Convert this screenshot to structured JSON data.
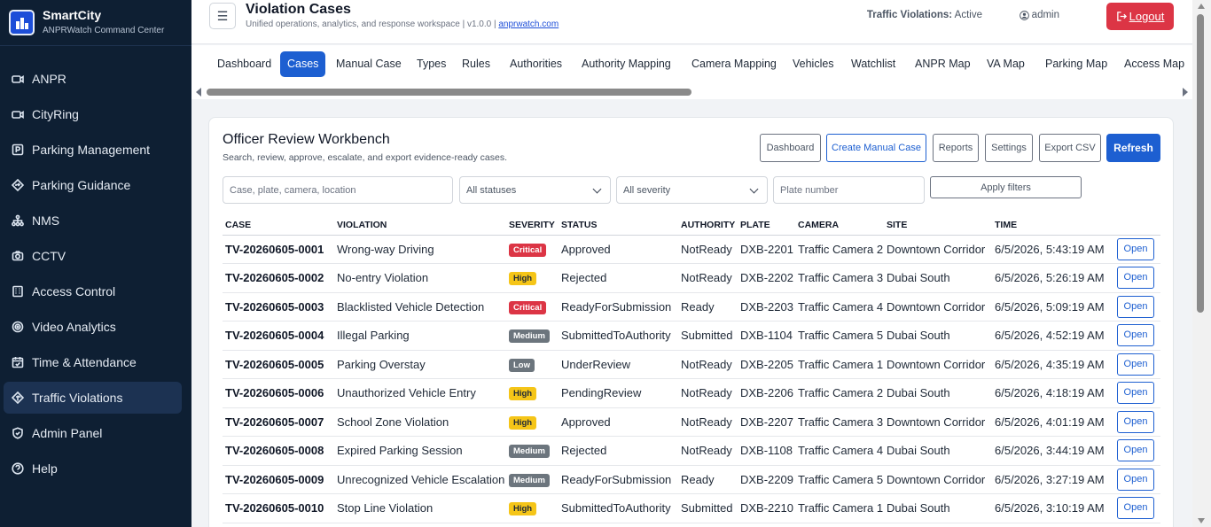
{
  "brand": {
    "title": "SmartCity",
    "subtitle": "ANPRWatch Command Center"
  },
  "sidebar": {
    "items": [
      {
        "label": "ANPR",
        "icon": "camera-icon"
      },
      {
        "label": "CityRing",
        "icon": "camera-icon"
      },
      {
        "label": "Parking Management",
        "icon": "parking-icon"
      },
      {
        "label": "Parking Guidance",
        "icon": "diamond-arrow-icon"
      },
      {
        "label": "NMS",
        "icon": "network-icon"
      },
      {
        "label": "CCTV",
        "icon": "cctv-icon"
      },
      {
        "label": "Access Control",
        "icon": "building-icon"
      },
      {
        "label": "Video Analytics",
        "icon": "target-icon"
      },
      {
        "label": "Time & Attendance",
        "icon": "calendar-check-icon"
      },
      {
        "label": "Traffic Violations",
        "icon": "signpost-icon",
        "active": true
      },
      {
        "label": "Admin Panel",
        "icon": "shield-icon"
      },
      {
        "label": "Help",
        "icon": "question-icon"
      }
    ]
  },
  "header": {
    "title": "Violation Cases",
    "subtitle_text": "Unified operations, analytics, and response workspace | v1.0.0 |",
    "subtitle_link": "anprwatch.com",
    "status_label": "Traffic Violations:",
    "status_value": "Active",
    "user": "admin",
    "logout_label": "Logout"
  },
  "tabs": [
    {
      "label": "Dashboard"
    },
    {
      "label": "Cases",
      "active": true
    },
    {
      "label": "Manual Case"
    },
    {
      "label": "Types"
    },
    {
      "label": "Rules"
    },
    {
      "label": "Authorities"
    },
    {
      "label": "Authority Mapping"
    },
    {
      "label": "Camera Mapping"
    },
    {
      "label": "Vehicles"
    },
    {
      "label": "Watchlist"
    },
    {
      "label": "ANPR Map"
    },
    {
      "label": "VA Map"
    },
    {
      "label": "Parking Map"
    },
    {
      "label": "Access Map"
    }
  ],
  "workbench": {
    "title": "Officer Review Workbench",
    "subtitle": "Search, review, approve, escalate, and export evidence-ready cases.",
    "buttons": {
      "dashboard": "Dashboard",
      "create_manual": "Create Manual Case",
      "reports": "Reports",
      "settings": "Settings",
      "export_csv": "Export CSV",
      "refresh": "Refresh"
    },
    "filters": {
      "search_placeholder": "Case, plate, camera, location",
      "status_selected": "All statuses",
      "severity_selected": "All severity",
      "plate_placeholder": "Plate number",
      "apply_label": "Apply filters"
    },
    "columns": [
      "CASE",
      "VIOLATION",
      "SEVERITY",
      "STATUS",
      "AUTHORITY",
      "PLATE",
      "CAMERA",
      "SITE",
      "TIME"
    ],
    "open_label": "Open",
    "rows": [
      {
        "case": "TV-20260605-0001",
        "violation": "Wrong-way Driving",
        "severity": "Critical",
        "status": "Approved",
        "authority": "NotReady",
        "plate": "DXB-2201",
        "camera": "Traffic Camera 2",
        "site": "Downtown Corridor",
        "time": "6/5/2026, 5:43:19 AM"
      },
      {
        "case": "TV-20260605-0002",
        "violation": "No-entry Violation",
        "severity": "High",
        "status": "Rejected",
        "authority": "NotReady",
        "plate": "DXB-2202",
        "camera": "Traffic Camera 3",
        "site": "Dubai South",
        "time": "6/5/2026, 5:26:19 AM"
      },
      {
        "case": "TV-20260605-0003",
        "violation": "Blacklisted Vehicle Detection",
        "severity": "Critical",
        "status": "ReadyForSubmission",
        "authority": "Ready",
        "plate": "DXB-2203",
        "camera": "Traffic Camera 4",
        "site": "Downtown Corridor",
        "time": "6/5/2026, 5:09:19 AM"
      },
      {
        "case": "TV-20260605-0004",
        "violation": "Illegal Parking",
        "severity": "Medium",
        "status": "SubmittedToAuthority",
        "authority": "Submitted",
        "plate": "DXB-1104",
        "camera": "Traffic Camera 5",
        "site": "Dubai South",
        "time": "6/5/2026, 4:52:19 AM"
      },
      {
        "case": "TV-20260605-0005",
        "violation": "Parking Overstay",
        "severity": "Low",
        "status": "UnderReview",
        "authority": "NotReady",
        "plate": "DXB-2205",
        "camera": "Traffic Camera 1",
        "site": "Downtown Corridor",
        "time": "6/5/2026, 4:35:19 AM"
      },
      {
        "case": "TV-20260605-0006",
        "violation": "Unauthorized Vehicle Entry",
        "severity": "High",
        "status": "PendingReview",
        "authority": "NotReady",
        "plate": "DXB-2206",
        "camera": "Traffic Camera 2",
        "site": "Dubai South",
        "time": "6/5/2026, 4:18:19 AM"
      },
      {
        "case": "TV-20260605-0007",
        "violation": "School Zone Violation",
        "severity": "High",
        "status": "Approved",
        "authority": "NotReady",
        "plate": "DXB-2207",
        "camera": "Traffic Camera 3",
        "site": "Downtown Corridor",
        "time": "6/5/2026, 4:01:19 AM"
      },
      {
        "case": "TV-20260605-0008",
        "violation": "Expired Parking Session",
        "severity": "Medium",
        "status": "Rejected",
        "authority": "NotReady",
        "plate": "DXB-1108",
        "camera": "Traffic Camera 4",
        "site": "Dubai South",
        "time": "6/5/2026, 3:44:19 AM"
      },
      {
        "case": "TV-20260605-0009",
        "violation": "Unrecognized Vehicle Escalation",
        "severity": "Medium",
        "status": "ReadyForSubmission",
        "authority": "Ready",
        "plate": "DXB-2209",
        "camera": "Traffic Camera 5",
        "site": "Downtown Corridor",
        "time": "6/5/2026, 3:27:19 AM"
      },
      {
        "case": "TV-20260605-0010",
        "violation": "Stop Line Violation",
        "severity": "High",
        "status": "SubmittedToAuthority",
        "authority": "Submitted",
        "plate": "DXB-2210",
        "camera": "Traffic Camera 1",
        "site": "Dubai South",
        "time": "6/5/2026, 3:10:19 AM"
      }
    ]
  },
  "colors": {
    "sidebar_bg": "#0e1f33",
    "primary": "#1d5fd1",
    "danger": "#dc3545",
    "warning": "#f5c518",
    "secondary": "#6c757d"
  }
}
